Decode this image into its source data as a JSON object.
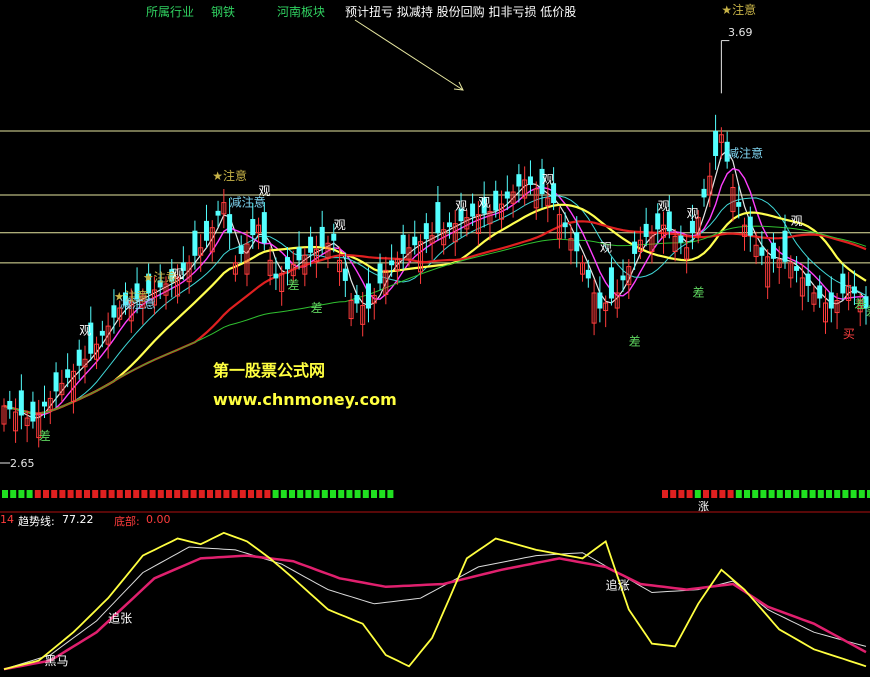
{
  "header": {
    "industry_label": "所属行业",
    "industry_value": "钢铁",
    "region_value": "河南板块",
    "tags": "预计扭亏 拟减持 股份回购 扣非亏损 低价股"
  },
  "watermark": {
    "name": "第一股票公式网",
    "url": "www.chnmoney.com"
  },
  "price_chart": {
    "high_label": "3.69",
    "low_label": "2.65",
    "ylim": [
      2.55,
      3.75
    ],
    "x_count": 150,
    "levels": [
      3.45,
      3.28,
      3.18,
      3.1
    ],
    "annotations": [
      {
        "text": "★注意",
        "i": 36,
        "v": 3.32,
        "color": "#c8b448"
      },
      {
        "text": "★注意",
        "i": 24,
        "v": 3.05,
        "color": "#c8b448"
      },
      {
        "text": "★注意",
        "i": 19,
        "v": 3.0,
        "color": "#c8b448"
      },
      {
        "text": "★注意",
        "i": 124,
        "v": 3.76,
        "color": "#c8b448"
      },
      {
        "text": "观",
        "i": 29,
        "v": 3.06,
        "color": "#ffffff"
      },
      {
        "text": "观",
        "i": 13,
        "v": 2.91,
        "color": "#ffffff"
      },
      {
        "text": "观",
        "i": 44,
        "v": 3.28,
        "color": "#ffffff"
      },
      {
        "text": "观",
        "i": 57,
        "v": 3.19,
        "color": "#ffffff"
      },
      {
        "text": "观",
        "i": 78,
        "v": 3.24,
        "color": "#ffffff"
      },
      {
        "text": "观",
        "i": 82,
        "v": 3.25,
        "color": "#ffffff"
      },
      {
        "text": "观",
        "i": 93,
        "v": 3.31,
        "color": "#ffffff"
      },
      {
        "text": "观",
        "i": 103,
        "v": 3.13,
        "color": "#ffffff"
      },
      {
        "text": "观",
        "i": 113,
        "v": 3.24,
        "color": "#ffffff"
      },
      {
        "text": "观",
        "i": 118,
        "v": 3.22,
        "color": "#ffffff"
      },
      {
        "text": "观",
        "i": 136,
        "v": 3.2,
        "color": "#ffffff"
      },
      {
        "text": "减注意",
        "i": 39,
        "v": 3.25,
        "color": "#7fd4f0"
      },
      {
        "text": "减注意",
        "i": 20,
        "v": 2.98,
        "color": "#7fd4f0"
      },
      {
        "text": "减注意",
        "i": 125,
        "v": 3.38,
        "color": "#7fd4f0"
      },
      {
        "text": "差",
        "i": 6,
        "v": 2.63,
        "color": "#5fd45f"
      },
      {
        "text": "差",
        "i": 49,
        "v": 3.03,
        "color": "#5fd45f"
      },
      {
        "text": "差",
        "i": 53,
        "v": 2.97,
        "color": "#5fd45f"
      },
      {
        "text": "差",
        "i": 108,
        "v": 2.88,
        "color": "#5fd45f"
      },
      {
        "text": "差",
        "i": 119,
        "v": 3.01,
        "color": "#5fd45f"
      },
      {
        "text": "差",
        "i": 147,
        "v": 2.98,
        "color": "#5fd45f"
      },
      {
        "text": "差",
        "i": 149,
        "v": 2.96,
        "color": "#5fd45f"
      },
      {
        "text": "买",
        "i": 145,
        "v": 2.9,
        "color": "#ff4040"
      }
    ]
  },
  "signal_bar": {
    "left_pattern": "ggggrrrrrrrrrrrrrrrrrrrrrrrrrrrrrggggggggggggggg",
    "right_pattern": "rrrrgrrrrggggggggggggggggg",
    "rise_label": "涨"
  },
  "indicator": {
    "num_label": "14",
    "trend_label": "趋势线:",
    "trend_value": "77.22",
    "bottom_label": "底部:",
    "bottom_value": "0.00",
    "ylim": [
      0,
      100
    ],
    "annotations": [
      {
        "text": "追张",
        "i": 18,
        "v": 35,
        "color": "#ffffff"
      },
      {
        "text": "黑马",
        "i": 7,
        "v": 5,
        "color": "#ffffff"
      },
      {
        "text": "追涨",
        "i": 104,
        "v": 58,
        "color": "#ffffff"
      }
    ]
  },
  "colors": {
    "up": "#ff3c3c",
    "down": "#54ffff",
    "ma_white": "#e6e6e6",
    "ma_yellow": "#ffff50",
    "ma_red": "#e02020",
    "ma_green": "#30c030",
    "ma_cyan": "#40d8d8",
    "ma_magenta": "#ff40ff",
    "level": "#e6e6a0",
    "ind_yellow": "#ffff40",
    "ind_magenta": "#e0206e",
    "ind_white": "#dcdcdc"
  }
}
